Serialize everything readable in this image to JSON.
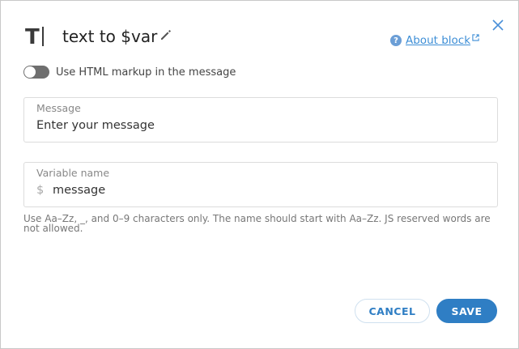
{
  "header": {
    "icon_letter": "T",
    "title": "text to $var",
    "about_label": "About block"
  },
  "options": {
    "html_markup_label": "Use HTML markup in the message",
    "html_markup_enabled": false
  },
  "message_field": {
    "label": "Message",
    "value": "Enter your message"
  },
  "variable_field": {
    "label": "Variable name",
    "prefix": "$",
    "value": "message"
  },
  "hint": "Use Aa–Zz, _, and 0–9 characters only. The name should start with Aa–Zz. JS reserved words are not allowed.",
  "actions": {
    "cancel_label": "CANCEL",
    "save_label": "SAVE"
  },
  "colors": {
    "accent": "#2f7ec4",
    "link": "#3d8ed6",
    "toggle_off": "#6f6f6f"
  }
}
